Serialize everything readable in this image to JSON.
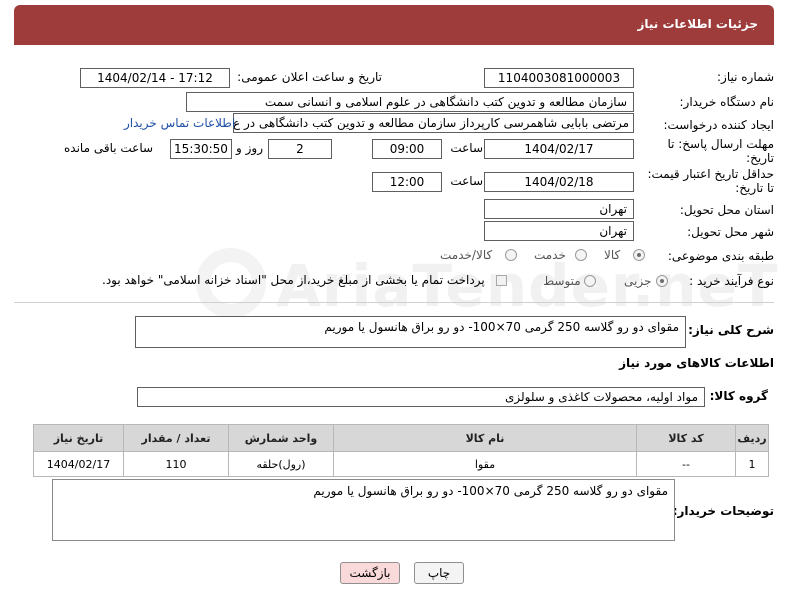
{
  "header": {
    "title": "جزئیات اطلاعات نیاز"
  },
  "form": {
    "need_number": {
      "label": "شماره نیاز:",
      "value": "1104003081000003"
    },
    "announce_datetime": {
      "label": "تاریخ و ساعت اعلان عمومی:",
      "value": "1404/02/14 - 17:12"
    },
    "buyer_org": {
      "label": "نام دستگاه خریدار:",
      "value": "سازمان مطالعه و تدوین کتب دانشگاهی در علوم اسلامی و انسانی سمت"
    },
    "requester": {
      "label": "ایجاد کننده درخواست:",
      "value": "مرتضی بابایی شاهمرسی کارپرداز سازمان مطالعه و تدوین کتب دانشگاهی در ع",
      "contact_link": "اطلاعات تماس خریدار"
    },
    "reply_deadline": {
      "label_line1": "مهلت ارسال پاسخ: تا",
      "label_line2": "تاریخ:",
      "date": "1404/02/17",
      "time_label": "ساعت",
      "time": "09:00",
      "days": "2",
      "days_label": "روز و",
      "remaining": "15:30:50",
      "remaining_label": "ساعت باقی مانده"
    },
    "price_validity": {
      "label_line1": "حداقل تاریخ اعتبار قیمت:",
      "label_line2": "تا تاریخ:",
      "date": "1404/02/18",
      "time_label": "ساعت",
      "time": "12:00"
    },
    "delivery_province": {
      "label": "استان محل تحویل:",
      "value": "تهران"
    },
    "delivery_city": {
      "label": "شهر محل تحویل:",
      "value": "تهران"
    },
    "category": {
      "label": "طبقه بندی موضوعی:",
      "options": [
        "کالا",
        "خدمت",
        "کالا/خدمت"
      ],
      "selected": "کالا"
    },
    "purchase_type": {
      "label": "نوع فرآیند خرید :",
      "options": [
        "جزیی",
        "متوسط"
      ],
      "selected": "جزیی",
      "payment_note": "پرداخت تمام یا بخشی از مبلغ خرید،از محل \"اسناد خزانه اسلامی\" خواهد بود."
    },
    "general_description": {
      "label": "شرح کلی نیاز:",
      "value": "مقوای دو رو گلاسه 250 گرمی 70×100- دو رو براق هانسول یا موریم"
    }
  },
  "goods": {
    "section_title": "اطلاعات کالاهای مورد نیاز",
    "group_label": "گروه کالا:",
    "group_value": "مواد اولیه، محصولات کاغذی و سلولزی",
    "columns": [
      "ردیف",
      "کد کالا",
      "نام کالا",
      "واحد شمارش",
      "تعداد / مقدار",
      "تاریخ نیاز"
    ],
    "rows": [
      [
        "1",
        "--",
        "مقوا",
        "(رول)حلقه",
        "110",
        "1404/02/17"
      ]
    ]
  },
  "buyer_notes": {
    "label": "توضیحات خریدار:",
    "value": "مقوای دو رو گلاسه 250 گرمی 70×100- دو رو براق هانسول یا موریم"
  },
  "buttons": {
    "print": "چاپ",
    "back": "بازگشت"
  },
  "watermark": {
    "brand": "AriaTender.neT"
  },
  "colors": {
    "header": "#9e3c3c",
    "link": "#1f4fa8",
    "back_button": "#f9d9d9"
  }
}
